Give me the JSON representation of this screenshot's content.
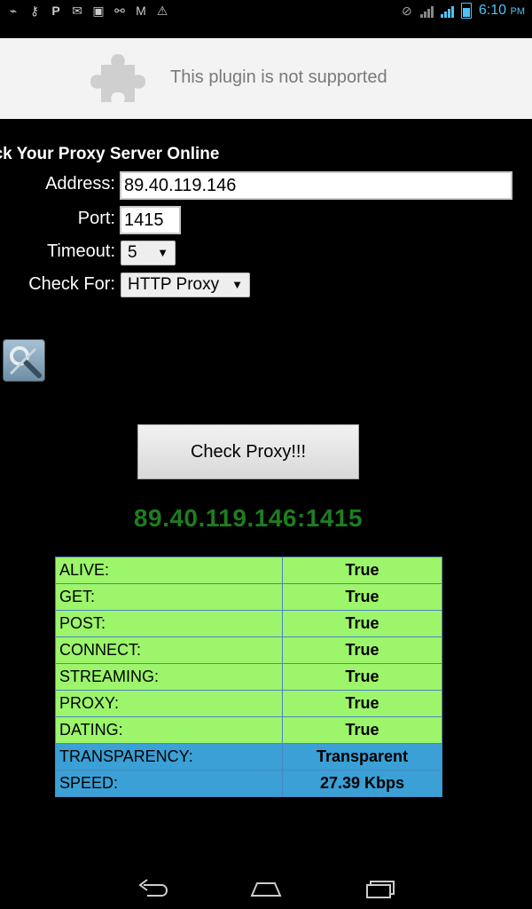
{
  "status_bar": {
    "time": "6:10",
    "ampm": "PM",
    "left_icons": [
      "usb-icon",
      "key-icon",
      "p-icon",
      "message-icon",
      "image-icon",
      "network-icon",
      "email-icon",
      "warning-icon"
    ],
    "accent": "#4fc3f7"
  },
  "plugin": {
    "message": "This plugin is not supported"
  },
  "form": {
    "heading": "eck Your Proxy Server Online",
    "address_label": "Address:",
    "address_value": "89.40.119.146",
    "port_label": "Port:",
    "port_value": "1415",
    "timeout_label": "Timeout:",
    "timeout_value": "5",
    "checkfor_label": "Check For:",
    "checkfor_value": "HTTP Proxy"
  },
  "check_button_label": "Check Proxy!!!",
  "result_address": "89.40.119.146:1415",
  "results": [
    {
      "key": "ALIVE:",
      "value": "True",
      "color": "green"
    },
    {
      "key": "GET:",
      "value": "True",
      "color": "green"
    },
    {
      "key": "POST:",
      "value": "True",
      "color": "green"
    },
    {
      "key": "CONNECT:",
      "value": "True",
      "color": "green"
    },
    {
      "key": "STREAMING:",
      "value": "True",
      "color": "green"
    },
    {
      "key": "PROXY:",
      "value": "True",
      "color": "green"
    },
    {
      "key": "DATING:",
      "value": "True",
      "color": "green"
    },
    {
      "key": "TRANSPARENCY:",
      "value": "Transparent",
      "color": "blue"
    },
    {
      "key": "SPEED:",
      "value": "27.39 Kbps",
      "color": "blue"
    }
  ],
  "colors": {
    "true_row": "#9cf56b",
    "info_row": "#3aa0d6",
    "result_address": "#1e7d1e"
  }
}
